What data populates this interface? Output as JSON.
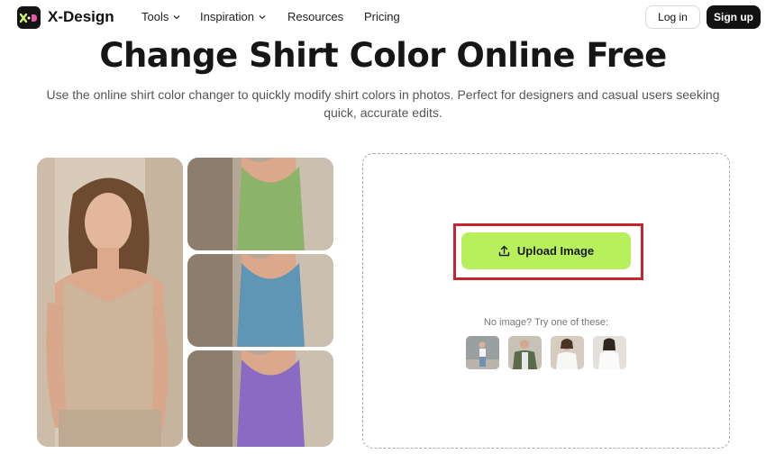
{
  "brand": {
    "name": "X-Design",
    "mark": "X·D"
  },
  "nav": {
    "items": [
      {
        "label": "Tools",
        "dropdown": true
      },
      {
        "label": "Inspiration",
        "dropdown": true
      },
      {
        "label": "Resources",
        "dropdown": false
      },
      {
        "label": "Pricing",
        "dropdown": false
      }
    ],
    "login": "Log in",
    "signup": "Sign up"
  },
  "hero": {
    "title": "Change Shirt Color Online Free",
    "subtitle": "Use the online shirt color changer to quickly modify shirt colors in photos. Perfect for designers and casual users seeking quick, accurate edits."
  },
  "gallery": {
    "main_shirt_color": "#cdb59b",
    "variant_colors": [
      "#8cb36a",
      "#5f95b5",
      "#8a6bc4"
    ]
  },
  "upload": {
    "button_label": "Upload Image",
    "sample_hint": "No image? Try one of these:"
  },
  "colors": {
    "accent": "#b7f05a",
    "highlight_box": "#c8242e",
    "brand_dark": "#141414"
  }
}
